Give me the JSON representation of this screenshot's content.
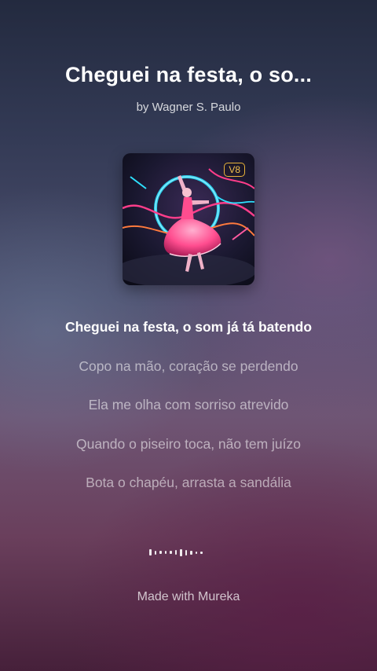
{
  "song": {
    "title": "Cheguei na festa, o so...",
    "artist": "by Wagner S. Paulo",
    "cover_badge": "V8"
  },
  "lyrics": {
    "lines": [
      "Cheguei na festa, o som já tá batendo",
      "Copo na mão, coração se perdendo",
      "Ela me olha com sorriso atrevido",
      "Quando o piseiro toca, não tem juízo",
      "Bota o chapéu, arrasta a sandália"
    ],
    "current_index": 0
  },
  "footer": {
    "text": "Made with Mureka"
  },
  "colors": {
    "badge": "#e7b23a",
    "neon_pink": "#ff3d8a",
    "neon_cyan": "#2de1ff"
  }
}
